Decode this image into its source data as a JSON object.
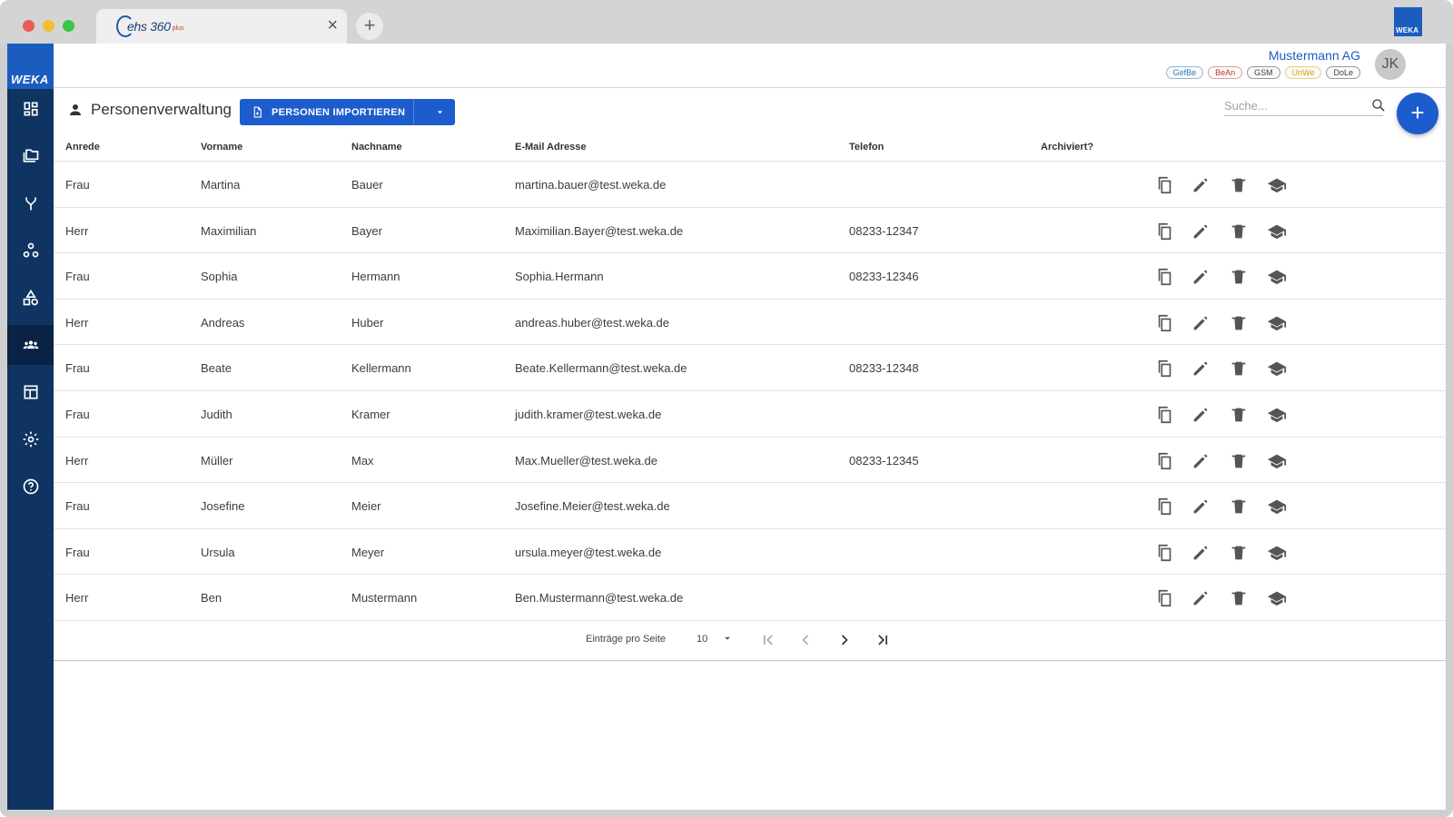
{
  "browser": {
    "tab_title": "ehs 360",
    "tab_suffix": "plus",
    "close_symbol": "×",
    "new_tab_symbol": "+",
    "corner_logo": "WEKA"
  },
  "sidebar": {
    "brand": "WEKA",
    "items": [
      {
        "icon": "dashboard-icon"
      },
      {
        "icon": "folders-icon"
      },
      {
        "icon": "fork-icon"
      },
      {
        "icon": "hierarchy-icon"
      },
      {
        "icon": "shapes-icon"
      },
      {
        "icon": "people-icon",
        "active": true
      },
      {
        "icon": "table-icon"
      },
      {
        "icon": "gear-icon"
      },
      {
        "icon": "help-icon"
      }
    ]
  },
  "header": {
    "company": "Mustermann AG",
    "badges": [
      {
        "label": "GefBe",
        "color": "#2a7bbf"
      },
      {
        "label": "BeAn",
        "color": "#c0392b"
      },
      {
        "label": "GSM",
        "color": "#444444"
      },
      {
        "label": "UnWe",
        "color": "#d4a000"
      },
      {
        "label": "DoLe",
        "color": "#444444"
      }
    ],
    "avatar_initials": "JK"
  },
  "page": {
    "title": "Personenverwaltung",
    "import_button": "PERSONEN IMPORTIEREN",
    "search_placeholder": "Suche...",
    "fab_label": "+"
  },
  "table": {
    "columns": [
      "Anrede",
      "Vorname",
      "Nachname",
      "E-Mail Adresse",
      "Telefon",
      "Archiviert?"
    ],
    "rows": [
      [
        "Frau",
        "Martina",
        "Bauer",
        "martina.bauer@test.weka.de",
        "",
        ""
      ],
      [
        "Herr",
        "Maximilian",
        "Bayer",
        "Maximilian.Bayer@test.weka.de",
        "08233-12347",
        ""
      ],
      [
        "Frau",
        "Sophia",
        "Hermann",
        "Sophia.Hermann",
        "08233-12346",
        ""
      ],
      [
        "Herr",
        "Andreas",
        "Huber",
        "andreas.huber@test.weka.de",
        "",
        ""
      ],
      [
        "Frau",
        "Beate",
        "Kellermann",
        "Beate.Kellermann@test.weka.de",
        "08233-12348",
        ""
      ],
      [
        "Frau",
        "Judith",
        "Kramer",
        "judith.kramer@test.weka.de",
        "",
        ""
      ],
      [
        "Herr",
        "Müller",
        "Max",
        "Max.Mueller@test.weka.de",
        "08233-12345",
        ""
      ],
      [
        "Frau",
        "Josefine",
        "Meier",
        "Josefine.Meier@test.weka.de",
        "",
        ""
      ],
      [
        "Frau",
        "Ursula",
        "Meyer",
        "ursula.meyer@test.weka.de",
        "",
        ""
      ],
      [
        "Herr",
        "Ben",
        "Mustermann",
        "Ben.Mustermann@test.weka.de",
        "",
        ""
      ]
    ],
    "row_actions": [
      "copy-icon",
      "edit-icon",
      "delete-icon",
      "training-icon"
    ]
  },
  "pagination": {
    "label": "Einträge pro Seite",
    "page_size": "10"
  },
  "colors": {
    "sidebar": "#0f3461",
    "accent": "#1d5ccc",
    "brand": "#1b5dbf"
  }
}
